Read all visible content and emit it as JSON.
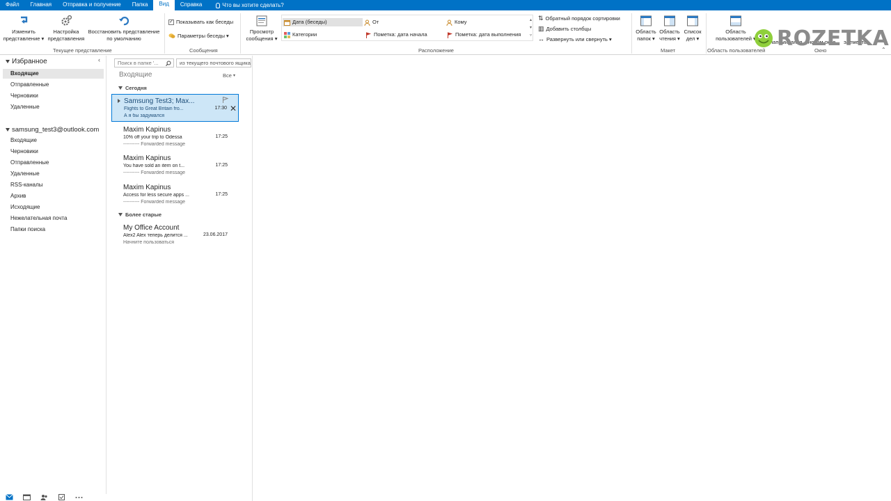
{
  "tabs": [
    {
      "label": "Файл"
    },
    {
      "label": "Главная"
    },
    {
      "label": "Отправка и получение"
    },
    {
      "label": "Папка"
    },
    {
      "label": "Вид"
    },
    {
      "label": "Справка"
    }
  ],
  "tell_me": "Что вы хотите сделать?",
  "ribbon": {
    "change_view": [
      "Изменить",
      "представление ▾"
    ],
    "view_settings": [
      "Настройка",
      "представления"
    ],
    "reset_view": [
      "Восстановить представление",
      "по умолчанию"
    ],
    "group_current_view": "Текущее представление",
    "show_conversations": "Показывать как беседы",
    "conversation_settings": "Параметры беседы ▾",
    "group_messages": "Сообщения",
    "message_preview": [
      "Просмотр",
      "сообщения ▾"
    ],
    "arr_date": "Дата (беседы)",
    "arr_from": "От",
    "arr_to": "Кому",
    "arr_categories": "Категории",
    "arr_flag_start": "Пометка: дата начала",
    "arr_flag_due": "Пометка: дата выполнения",
    "reverse_sort": "Обратный порядок сортировки",
    "add_columns": "Добавить столбцы",
    "expand_collapse": "Развернуть или свернуть ▾",
    "group_arrangement": "Расположение",
    "folder_pane": [
      "Область",
      "папок ▾"
    ],
    "reading_pane": [
      "Область",
      "чтения ▾"
    ],
    "todo_bar": [
      "Список",
      "дел ▾"
    ],
    "group_layout": "Макет",
    "people_pane": [
      "Область",
      "пользователей ▾"
    ],
    "group_people": "Область пользователей",
    "reminders": "напоминания",
    "new_window": "новом окне",
    "close_items": "элементы",
    "group_window": "Окно",
    "logo": "ROZETKA"
  },
  "folders": {
    "favorites_label": "Избранное",
    "favorites": [
      "Входящие",
      "Отправленные",
      "Черновики",
      "Удаленные"
    ],
    "account": "samsung_test3@outlook.com",
    "account_folders": [
      "Входящие",
      "Черновики",
      "Отправленные",
      "Удаленные",
      "RSS-каналы",
      "Архив",
      "Исходящие",
      "Нежелательная почта",
      "Папки поиска"
    ]
  },
  "search": {
    "placeholder": "Поиск в папке '...",
    "scope": "из текущего почтового ящика"
  },
  "list": {
    "title": "Входящие",
    "filter": "Все",
    "group_today": "Сегодня",
    "group_older": "Более старые",
    "messages": [
      {
        "sender": "Samsung Test3;  Max...",
        "subject": "Flights to Great Britain fro...",
        "preview": "А я бы задумался",
        "time": "17:30"
      },
      {
        "sender": "Maxim Kapinus",
        "subject": "10% off your trip to Odessa",
        "preview": "---------- Forwarded message",
        "time": "17:25"
      },
      {
        "sender": "Maxim Kapinus",
        "subject": "You have sold an item on t...",
        "preview": "---------- Forwarded message",
        "time": "17:25"
      },
      {
        "sender": "Maxim Kapinus",
        "subject": "Access for less secure apps ...",
        "preview": "---------- Forwarded message",
        "time": "17:25"
      },
      {
        "sender": "My Office Account",
        "subject": "Alex2 Alex теперь делится ...",
        "preview": "Начните пользоваться",
        "time": "23.06.2017"
      }
    ]
  }
}
